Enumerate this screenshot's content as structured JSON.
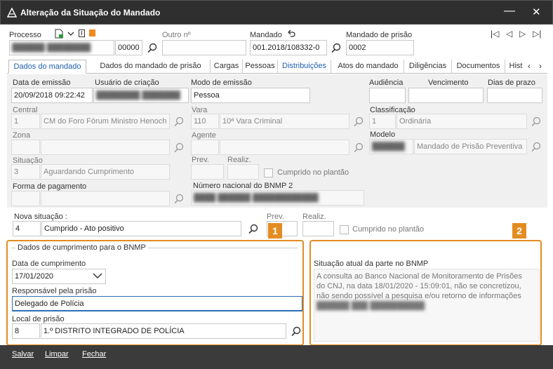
{
  "window": {
    "title": "Alteração da Situação do Mandado",
    "minimize": "—",
    "close": "✕"
  },
  "header": {
    "processo_label": "Processo",
    "processo_number_suffix": "00000",
    "outro_label": "Outro nº",
    "mandado_label": "Mandado",
    "mandado_value": "001.2018/108332-0",
    "mandado_prisao_label": "Mandado de prisão",
    "mandado_prisao_value": "0002"
  },
  "nav": {
    "first": "|◁",
    "prev": "◁",
    "next": "▷",
    "last": "▷|"
  },
  "tabs": [
    {
      "label": "Dados do mandado"
    },
    {
      "label": "Dados do mandado de prisão"
    },
    {
      "label": "Cargas"
    },
    {
      "label": "Pessoas"
    },
    {
      "label": "Distribuições"
    },
    {
      "label": "Atos do mandado"
    },
    {
      "label": "Diligências"
    },
    {
      "label": "Documentos"
    },
    {
      "label": "Hist"
    }
  ],
  "form": {
    "data_emissao_label": "Data de emissão",
    "data_emissao_value": "20/09/2018 09:22:42",
    "usuario_label": "Usuário de criação",
    "modo_label": "Modo de emissão",
    "modo_value": "Pessoa",
    "audiencia_label": "Audiência",
    "vencimento_label": "Vencimento",
    "dias_label": "Dias de prazo",
    "central_label": "Central",
    "central_code": "1",
    "central_value": "CM do Foro Fórum Ministro Henoch",
    "vara_label": "Vara",
    "vara_code": "110",
    "vara_value": "10ª Vara Criminal",
    "classificacao_label": "Classificação",
    "classificacao_code": "1",
    "classificacao_value": "Ordinária",
    "zona_label": "Zona",
    "agente_label": "Agente",
    "modelo_label": "Modelo",
    "modelo_value": "Mandado de Prisão Preventiva",
    "situacao_label": "Situação",
    "situacao_code": "3",
    "situacao_value": "Aguardando Cumprimento",
    "prev_label": "Prev.",
    "realiz_label": "Realiz.",
    "cumprido_label": "Cumprido no plantão",
    "forma_label": "Forma de pagamento",
    "bnmp2_label": "Número nacional do BNMP 2"
  },
  "nova": {
    "label": "Nova situação :",
    "code": "4",
    "value": "Cumprido - Ato positivo",
    "prev_label": "Prev.",
    "realiz_label": "Realiz.",
    "cumprido_label": "Cumprido no plantão"
  },
  "bnmp": {
    "group_title": "Dados de cumprimento para o BNMP",
    "data_label": "Data de cumprimento",
    "data_value": "17/01/2020",
    "responsavel_label": "Responsável pela prisão",
    "responsavel_value": "Delegado de Polícia",
    "local_label": "Local de prisão",
    "local_code": "8",
    "local_value": "1.º DISTRITO INTEGRADO DE POLÍCIA"
  },
  "situacao_atual": {
    "label": "Situação atual da parte no BNMP",
    "line1": "A consulta ao Banco Nacional de Monitoramento de Prisões",
    "line2": "do CNJ, na data 18/01/2020 - 15:09:01, não se concretizou,",
    "line3": "não sendo possível a pesquisa e/ou retorno de informações"
  },
  "badges": {
    "one": "1",
    "two": "2"
  },
  "footer": {
    "salvar": "Salvar",
    "limpar": "Limpar",
    "fechar": "Fechar"
  },
  "colors": {
    "accent_orange": "#e38c21",
    "titlebar": "#2f2f2f",
    "tab_blue": "#1e5fae"
  }
}
